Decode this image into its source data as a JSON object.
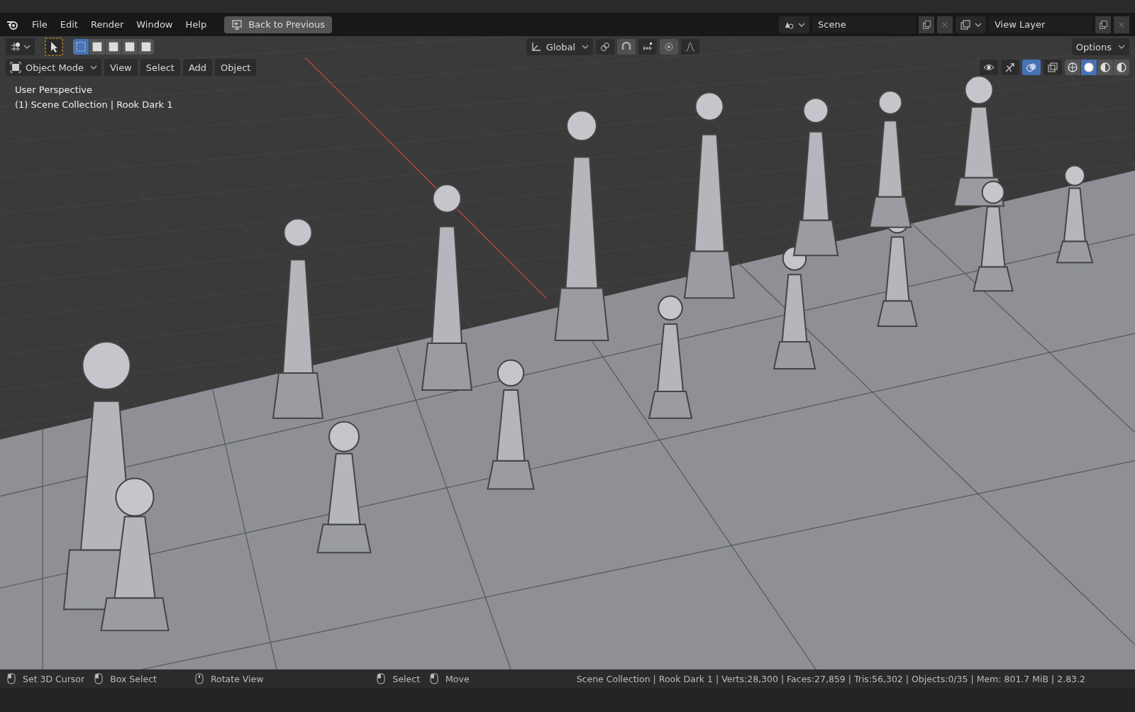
{
  "menu": [
    "File",
    "Edit",
    "Render",
    "Window",
    "Help"
  ],
  "back_button": "Back to Previous",
  "scene": {
    "value": "Scene"
  },
  "view_layer": {
    "value": "View Layer"
  },
  "toolbar": {
    "select_modes": [
      {
        "selected": true
      },
      {
        "selected": false
      },
      {
        "selected": false
      },
      {
        "selected": false
      },
      {
        "selected": false
      }
    ],
    "orientation": "Global",
    "options": "Options"
  },
  "header": {
    "mode": "Object Mode",
    "menus": [
      "View",
      "Select",
      "Add",
      "Object"
    ],
    "overlays_on": true,
    "shading": [
      {
        "selected": false
      },
      {
        "selected": true
      },
      {
        "selected": false
      },
      {
        "selected": false
      }
    ]
  },
  "viewport": {
    "view_name": "User Perspective",
    "collection": "(1) Scene Collection | Rook Dark 1"
  },
  "status_bar": {
    "hints": [
      "Set 3D Cursor",
      "Box Select",
      "Rotate View",
      "Select",
      "Move"
    ],
    "stats": "Scene Collection | Rook Dark 1 | Verts:28,300 | Faces:27,859 | Tris:56,302 | Objects:0/35 | Mem: 801.7 MiB | 2.83.2"
  }
}
